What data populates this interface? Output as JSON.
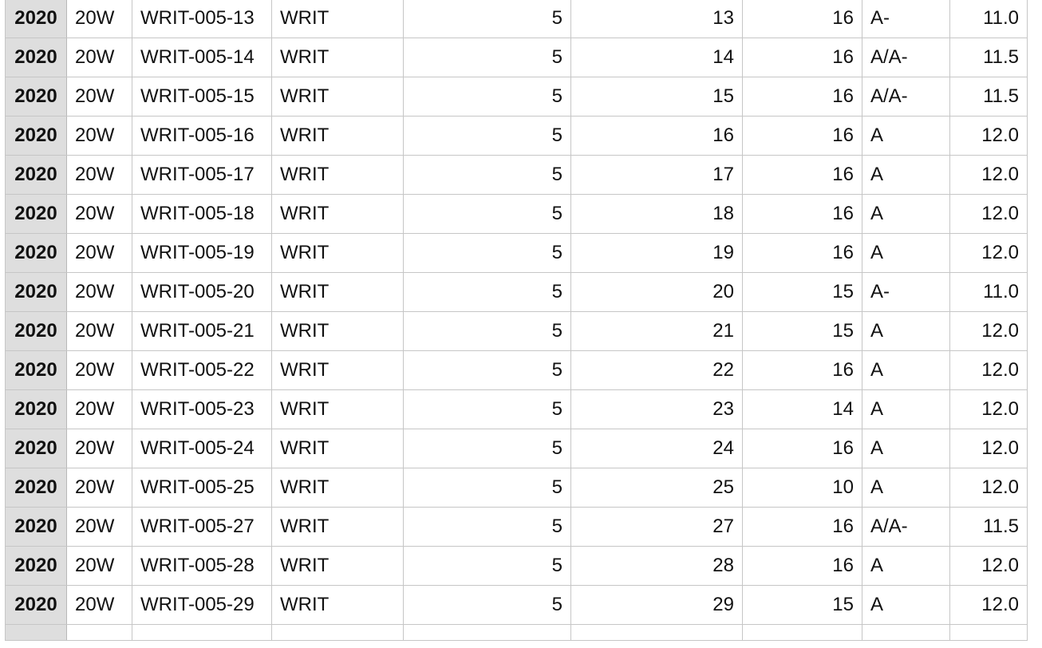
{
  "rows": [
    [
      "2020",
      "20W",
      "WRIT-005-13",
      "WRIT",
      "5",
      "13",
      "16",
      "A-",
      "11.0"
    ],
    [
      "2020",
      "20W",
      "WRIT-005-14",
      "WRIT",
      "5",
      "14",
      "16",
      "A/A-",
      "11.5"
    ],
    [
      "2020",
      "20W",
      "WRIT-005-15",
      "WRIT",
      "5",
      "15",
      "16",
      "A/A-",
      "11.5"
    ],
    [
      "2020",
      "20W",
      "WRIT-005-16",
      "WRIT",
      "5",
      "16",
      "16",
      "A",
      "12.0"
    ],
    [
      "2020",
      "20W",
      "WRIT-005-17",
      "WRIT",
      "5",
      "17",
      "16",
      "A",
      "12.0"
    ],
    [
      "2020",
      "20W",
      "WRIT-005-18",
      "WRIT",
      "5",
      "18",
      "16",
      "A",
      "12.0"
    ],
    [
      "2020",
      "20W",
      "WRIT-005-19",
      "WRIT",
      "5",
      "19",
      "16",
      "A",
      "12.0"
    ],
    [
      "2020",
      "20W",
      "WRIT-005-20",
      "WRIT",
      "5",
      "20",
      "15",
      "A-",
      "11.0"
    ],
    [
      "2020",
      "20W",
      "WRIT-005-21",
      "WRIT",
      "5",
      "21",
      "15",
      "A",
      "12.0"
    ],
    [
      "2020",
      "20W",
      "WRIT-005-22",
      "WRIT",
      "5",
      "22",
      "16",
      "A",
      "12.0"
    ],
    [
      "2020",
      "20W",
      "WRIT-005-23",
      "WRIT",
      "5",
      "23",
      "14",
      "A",
      "12.0"
    ],
    [
      "2020",
      "20W",
      "WRIT-005-24",
      "WRIT",
      "5",
      "24",
      "16",
      "A",
      "12.0"
    ],
    [
      "2020",
      "20W",
      "WRIT-005-25",
      "WRIT",
      "5",
      "25",
      "10",
      "A",
      "12.0"
    ],
    [
      "2020",
      "20W",
      "WRIT-005-27",
      "WRIT",
      "5",
      "27",
      "16",
      "A/A-",
      "11.5"
    ],
    [
      "2020",
      "20W",
      "WRIT-005-28",
      "WRIT",
      "5",
      "28",
      "16",
      "A",
      "12.0"
    ],
    [
      "2020",
      "20W",
      "WRIT-005-29",
      "WRIT",
      "5",
      "29",
      "15",
      "A",
      "12.0"
    ]
  ]
}
